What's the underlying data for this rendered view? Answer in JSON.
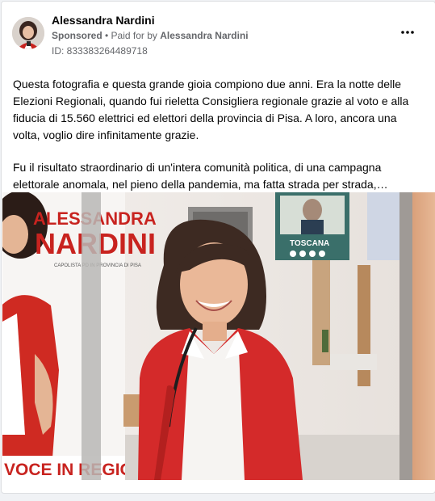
{
  "post": {
    "author_name": "Alessandra Nardini",
    "sponsored_label": "Sponsored",
    "separator": " • ",
    "paid_for_prefix": "Paid for by ",
    "paid_for_name": "Alessandra Nardini",
    "ad_id": "ID: 833383264489718",
    "paragraphs": [
      "Questa fotografia e questa grande gioia compiono due anni. Era la notte delle Elezioni Regionali, quando fui rieletta Consigliera regionale grazie al voto e alla fiducia di 15.560 elettrici ed elettori della provincia di Pisa. A loro, ancora una volta, voglio dire infinitamente grazie.",
      "Fu il risultato straordinario di un'intera comunità politica, di una campagna elettorale anomala, nel pieno della pandemia, ma fatta strada per strada,…"
    ],
    "more_options_icon": "more-horizontal-icon"
  },
  "photo": {
    "banner_left_name_1": "ALESSANDRA",
    "banner_left_name_2": "NARDINI",
    "banner_left_sub": "CAPOLISTA PD IN PROVINCIA DI PISA",
    "banner_left_bottom": "VOCE IN REGIONE",
    "poster_title": "TOSCANA"
  },
  "colors": {
    "accent_red": "#d42a2a",
    "meta_gray": "#65676b"
  }
}
